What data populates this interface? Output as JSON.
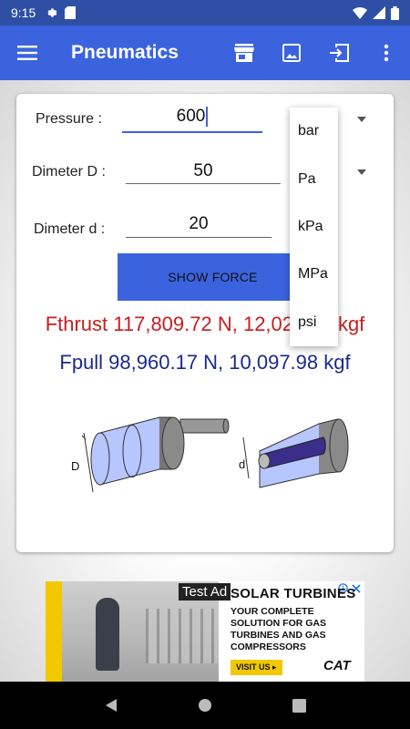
{
  "status": {
    "time": "9:15"
  },
  "app": {
    "title": "Pneumatics",
    "actions": [
      "store-icon",
      "image-icon",
      "exit-icon",
      "more-vert-icon"
    ]
  },
  "form": {
    "pressure": {
      "label": "Pressure :",
      "value": "600"
    },
    "diameter_D": {
      "label": "Dimeter D :",
      "value": "50"
    },
    "diameter_d": {
      "label": "Dimeter d :",
      "value": "20"
    },
    "button": "SHOW FORCE"
  },
  "results": {
    "thrust": "Fthrust 117,809.72 N, 12,021.40 kgf",
    "pull": "Fpull 98,960.17 N, 10,097.98 kgf"
  },
  "diagram": {
    "label_D": "D",
    "label_d": "d"
  },
  "unit_menu": {
    "options": [
      "bar",
      "Pa",
      "kPa",
      "MPa",
      "psi"
    ]
  },
  "ad": {
    "tag": "Test Ad",
    "headline": "SOLAR TURBINES",
    "body": "YOUR COMPLETE SOLUTION FOR GAS TURBINES AND GAS COMPRESSORS",
    "cta": "VISIT US ▸",
    "brand": "CAT"
  },
  "colors": {
    "primary": "#3b63de",
    "statusbar": "#2e4fa3",
    "thrust": "#c81e1e",
    "pull": "#1b2a8a"
  }
}
